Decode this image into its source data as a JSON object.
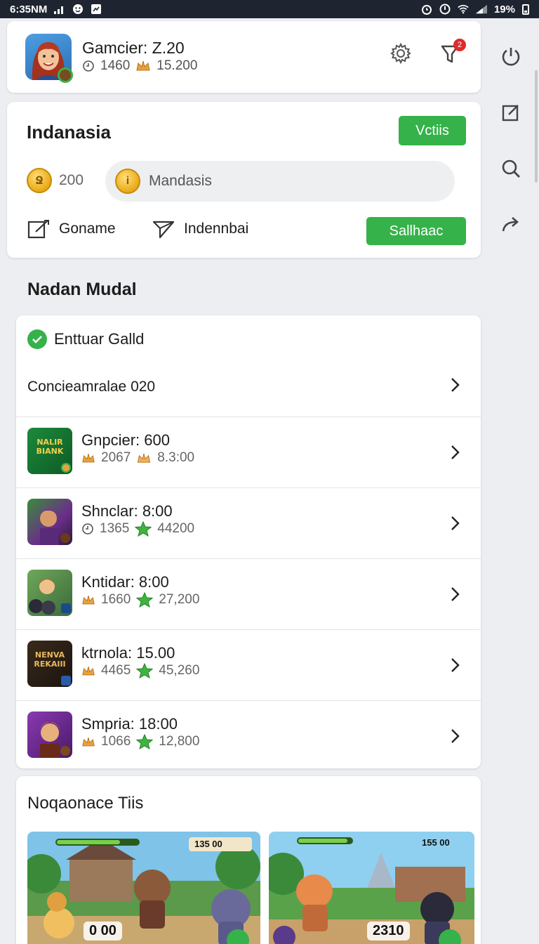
{
  "status_bar": {
    "time": "6:35NM",
    "battery": "19%"
  },
  "profile": {
    "name": "Gamcier: Z.20",
    "stat1": "1460",
    "stat2": "15.200"
  },
  "notifications": {
    "count": "2"
  },
  "indanasia": {
    "title": "Indanasia",
    "votes_button": "Vctiis",
    "coins": "200",
    "search_placeholder": "Mandasis",
    "action_gonane": "Goname",
    "action_indennbai": "Indennbai",
    "sall_button": "Sallhaac"
  },
  "section_title": "Nadan Mudal",
  "list": {
    "header": "Enttuar Galld",
    "subheader": "Concieamralae 020",
    "rows": [
      {
        "name": "Gnpcier: 600",
        "stat1": "2067",
        "stat2": "8.3:00",
        "thumb_text": "NALIR BIANK"
      },
      {
        "name": "Shnclar: 8:00",
        "stat1": "1365",
        "stat2": "44200",
        "thumb_text": ""
      },
      {
        "name": "Kntidar: 8:00",
        "stat1": "1660",
        "stat2": "27,200",
        "thumb_text": ""
      },
      {
        "name": "ktrnola: 15.00",
        "stat1": "4465",
        "stat2": "45,260",
        "thumb_text": "NENVA REKAIII"
      },
      {
        "name": "Smpria: 18:00",
        "stat1": "1066",
        "stat2": "12,800",
        "thumb_text": ""
      }
    ]
  },
  "tips": {
    "title": "Noqaonace Tiis",
    "shot1_score": "0 00",
    "shot1_hud": "135 00",
    "shot2_score": "2310",
    "shot2_hud": "155 00"
  },
  "colors": {
    "accent_green": "#35b24a",
    "badge_red": "#e02a2a",
    "statusbar": "#1e2430"
  }
}
